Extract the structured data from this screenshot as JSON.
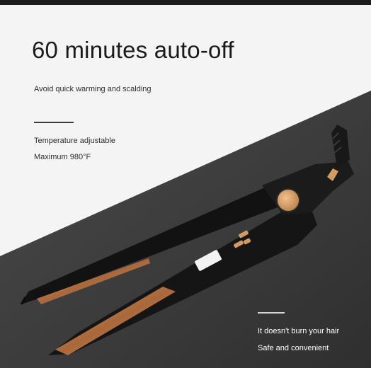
{
  "headline": "60 minutes auto-off",
  "subline": "Avoid quick warming and scalding",
  "features_top": [
    "Temperature adjustable",
    "Maximum 980°F"
  ],
  "features_bottom": [
    "It doesn't burn your hair",
    "Safe and convenient"
  ],
  "colors": {
    "background": "#f4f4f4",
    "dark_band": "#3c3c3c",
    "iron_body": "#141414",
    "accent_gold": "#d49a62",
    "plate_bronze": "#b9743f"
  }
}
